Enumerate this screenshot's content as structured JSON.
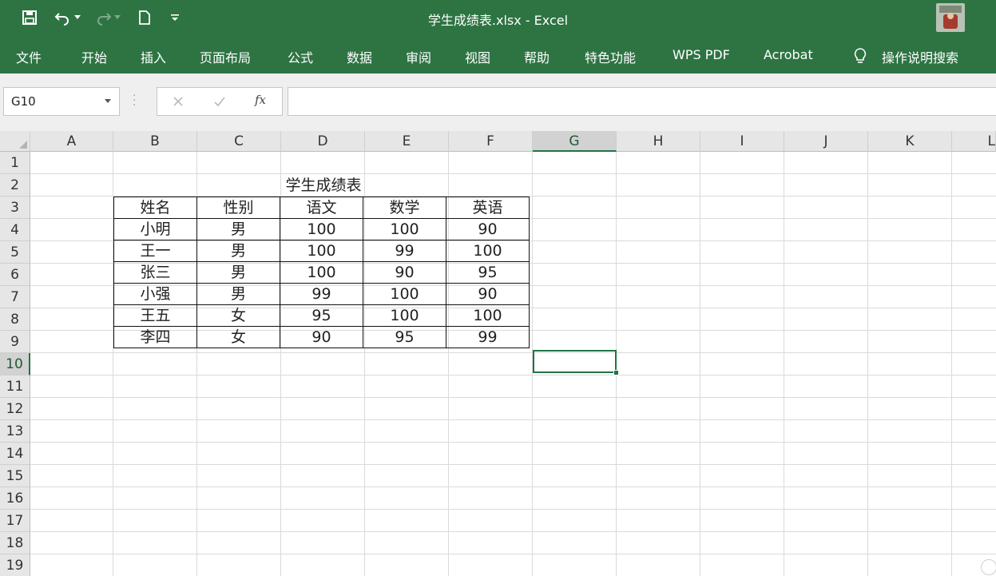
{
  "window": {
    "title": "学生成绩表.xlsx  -  Excel"
  },
  "ribbon_tabs": [
    "文件",
    "开始",
    "插入",
    "页面布局",
    "公式",
    "数据",
    "审阅",
    "视图",
    "帮助",
    "特色功能",
    "WPS PDF",
    "Acrobat"
  ],
  "tell_me": "操作说明搜索",
  "formula_bar": {
    "name_box": "G10",
    "fx_label": "fx",
    "formula": ""
  },
  "columns": [
    "A",
    "B",
    "C",
    "D",
    "E",
    "F",
    "G",
    "H",
    "I",
    "J",
    "K",
    "L"
  ],
  "rows": [
    "1",
    "2",
    "3",
    "4",
    "5",
    "6",
    "7",
    "8",
    "9",
    "10",
    "11",
    "12",
    "13",
    "14",
    "15",
    "16",
    "17",
    "18",
    "19"
  ],
  "selected": {
    "column": "G",
    "row": "10"
  },
  "sheet": {
    "title": "学生成绩表",
    "table": [
      [
        "姓名",
        "性别",
        "语文",
        "数学",
        "英语"
      ],
      [
        "小明",
        "男",
        "100",
        "100",
        "90"
      ],
      [
        "王一",
        "男",
        "100",
        "99",
        "100"
      ],
      [
        "张三",
        "男",
        "100",
        "90",
        "95"
      ],
      [
        "小强",
        "男",
        "99",
        "100",
        "90"
      ],
      [
        "王五",
        "女",
        "95",
        "100",
        "100"
      ],
      [
        "李四",
        "女",
        "90",
        "95",
        "99"
      ]
    ]
  },
  "colors": {
    "ribbon": "#2e7443",
    "selection": "#217346"
  }
}
